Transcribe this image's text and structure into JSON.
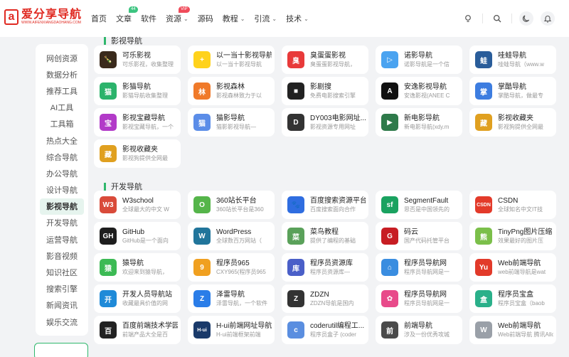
{
  "header": {
    "logo_mark": "a",
    "logo_title": "爱分享导航",
    "logo_subtitle": "WWW.AIFENXIANGDAOHANG.COM",
    "nav": [
      {
        "label": "首页",
        "badge": "",
        "caret": false
      },
      {
        "label": "文章",
        "badge": "44",
        "caret": false
      },
      {
        "label": "软件",
        "badge": "",
        "caret": false
      },
      {
        "label": "资源",
        "badge": "VIP",
        "caret": true
      },
      {
        "label": "源码",
        "badge": "",
        "caret": false
      },
      {
        "label": "教程",
        "badge": "",
        "caret": true
      },
      {
        "label": "引流",
        "badge": "",
        "caret": true
      },
      {
        "label": "技术",
        "badge": "",
        "caret": true
      }
    ],
    "icons": [
      "idea-bulb-icon",
      "search-icon",
      "moon-icon",
      "bell-icon"
    ]
  },
  "sidebar": {
    "items": [
      {
        "label": "网创资源"
      },
      {
        "label": "数据分析"
      },
      {
        "label": "推荐工具"
      },
      {
        "label": "AI工具"
      },
      {
        "label": "工具箱"
      },
      {
        "label": "热点大全"
      },
      {
        "label": "综合导航"
      },
      {
        "label": "办公导航"
      },
      {
        "label": "设计导航"
      },
      {
        "label": "影视导航"
      },
      {
        "label": "开发导航"
      },
      {
        "label": "运营导航"
      },
      {
        "label": "影音视频"
      },
      {
        "label": "知识社区"
      },
      {
        "label": "搜索引擎"
      },
      {
        "label": "新闻资讯"
      },
      {
        "label": "娱乐交流"
      }
    ],
    "active": "影视导航"
  },
  "sections": [
    {
      "title": "影视导航",
      "cards": [
        {
          "title": "可乐影视",
          "desc": "可乐影视，收集整理",
          "color": "#3a2a1c",
          "glyph": "🍾"
        },
        {
          "title": "以一当十影视导航",
          "desc": "以一当十影视导航",
          "color": "#ffd21c",
          "glyph": "+"
        },
        {
          "title": "臭蛋蛋影视",
          "desc": "臭蛋蛋影视导航，",
          "color": "#e83a3a",
          "glyph": "臭"
        },
        {
          "title": "诺影导航",
          "desc": "诺影导航是一个信",
          "color": "#4aa3f0",
          "glyph": "▷"
        },
        {
          "title": "哇蛙导航",
          "desc": "哇蛙导航（www.w",
          "color": "#2a5d9a",
          "glyph": "蛙"
        },
        {
          "title": "影猫导航",
          "desc": "影猫导航收集整理",
          "color": "#2bb36b",
          "glyph": "猫"
        },
        {
          "title": "影视森林",
          "desc": "影视森林致力于以",
          "color": "#f07a2a",
          "glyph": "林"
        },
        {
          "title": "影剧搜",
          "desc": "免费电影搜索引擎",
          "color": "#222222",
          "glyph": "■"
        },
        {
          "title": "安逸影视导航",
          "desc": "安逸影视(ANEE C",
          "color": "#111111",
          "glyph": "A"
        },
        {
          "title": "掌酷导航",
          "desc": "掌酷导航，做最专",
          "color": "#3d7de0",
          "glyph": "掌"
        },
        {
          "title": "影视宝藏导航",
          "desc": "影视宝藏导航，一个",
          "color": "#b23ac8",
          "glyph": "宝"
        },
        {
          "title": "猫影导航",
          "desc": "猫影影视导航—",
          "color": "#5b8de8",
          "glyph": "猫"
        },
        {
          "title": "DY003电影网址...",
          "desc": "影视资源专用网址",
          "color": "#333333",
          "glyph": "D"
        },
        {
          "title": "新电影导航",
          "desc": "新电影导航(xdy.m",
          "color": "#2e7a4a",
          "glyph": "▶"
        },
        {
          "title": "影视收藏夹",
          "desc": "影视狗提供全网最",
          "color": "#e0a020",
          "glyph": "藏"
        },
        {
          "title": "影视收藏夹",
          "desc": "影视狗提供全网最",
          "color": "#e0a020",
          "glyph": "藏"
        }
      ]
    },
    {
      "title": "开发导航",
      "cards": [
        {
          "title": "W3school",
          "desc": "全球最大的中文 W",
          "color": "#d94b3a",
          "glyph": "W3"
        },
        {
          "title": "360站长平台",
          "desc": "360站长平台是360",
          "color": "#55b54a",
          "glyph": "O"
        },
        {
          "title": "百度搜索资源平台",
          "desc": "百度搜索面向合作",
          "color": "#2f6de0",
          "glyph": "🐾"
        },
        {
          "title": "SegmentFault",
          "desc": "思否是中国领先的",
          "color": "#1aa260",
          "glyph": "sf"
        },
        {
          "title": "CSDN",
          "desc": "全球知名中文IT技",
          "color": "#e33a2a",
          "glyph": "CSDN"
        },
        {
          "title": "GitHub",
          "desc": "GitHub是一个面向",
          "color": "#1e1e1e",
          "glyph": "GH"
        },
        {
          "title": "WordPress",
          "desc": "全球数百万网站（",
          "color": "#21759b",
          "glyph": "W"
        },
        {
          "title": "菜鸟教程",
          "desc": "提供了编程的基础",
          "color": "#5aa15a",
          "glyph": "菜"
        },
        {
          "title": "码云",
          "desc": "国产代码托管平台",
          "color": "#c71d23",
          "glyph": "G"
        },
        {
          "title": "TinyPng图片压缩",
          "desc": "效果最好的图片压",
          "color": "#7bbf4a",
          "glyph": "熊"
        },
        {
          "title": "猿导航",
          "desc": "欢迎来到猿导航，",
          "color": "#3cba54",
          "glyph": "猿"
        },
        {
          "title": "程序员965",
          "desc": "CXY965(程序员965",
          "color": "#f0a020",
          "glyph": "9"
        },
        {
          "title": "程序员资源库",
          "desc": "程序员资源库—",
          "color": "#4a5fc8",
          "glyph": "库"
        },
        {
          "title": "程序员导航网",
          "desc": "程序员导航网是一",
          "color": "#3a8de0",
          "glyph": "⌂"
        },
        {
          "title": "Web前端导航",
          "desc": "web前端导航是wat",
          "color": "#e23a2a",
          "glyph": "Yu"
        },
        {
          "title": "开发人员导航站",
          "desc": "收藏最具价值的网",
          "color": "#1f8ad8",
          "glyph": "开"
        },
        {
          "title": "泽雷导航",
          "desc": "泽雷导航，一个软件",
          "color": "#2a7de8",
          "glyph": "Z"
        },
        {
          "title": "ZDZN",
          "desc": "ZDZN导航是国内",
          "color": "#333333",
          "glyph": "Z"
        },
        {
          "title": "程序员导航网",
          "desc": "程序员导航网是一",
          "color": "#e84a8a",
          "glyph": "✿"
        },
        {
          "title": "程序员宝盒",
          "desc": "程序员宝盒（baob",
          "color": "#2ab08a",
          "glyph": "盒"
        },
        {
          "title": "百度前端技术学园",
          "desc": "前端产品大全是百",
          "color": "#222222",
          "glyph": "百"
        },
        {
          "title": "H-ui前端网址导航",
          "desc": "H-ui前端框架前端",
          "color": "#1a3a6a",
          "glyph": "H-ui"
        },
        {
          "title": "coderutil编程工...",
          "desc": "程序员盒子 (coder",
          "color": "#5a8ee0",
          "glyph": "c"
        },
        {
          "title": "前端导航",
          "desc": "涉及一份优秀攻城",
          "color": "#4a4a4a",
          "glyph": "前"
        },
        {
          "title": "Web前端导航",
          "desc": "Web前端导航 腾讯Allo",
          "color": "#9aa0a8",
          "glyph": "W"
        }
      ]
    }
  ]
}
